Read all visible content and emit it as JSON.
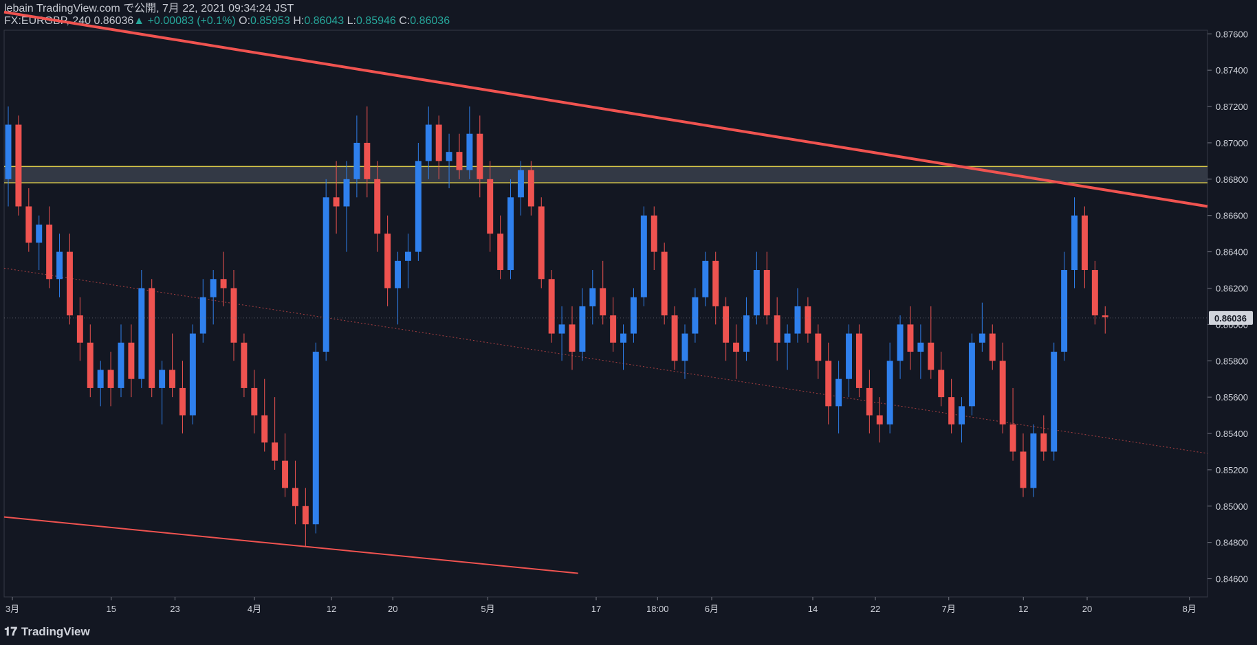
{
  "header": {
    "published": "lebain TradingView.com で公開, 7月 22, 2021 09:34:24 JST",
    "symbol": "FX:EURGBP, 240",
    "last": "0.86036",
    "change_arrow": "▲",
    "change": "+0.00083 (+0.1%)",
    "o_label": "O:",
    "o_value": "0.85953",
    "h_label": "H:",
    "h_value": "0.86043",
    "l_label": "L:",
    "l_value": "0.85946",
    "c_label": "C:",
    "c_value": "0.86036"
  },
  "footer": {
    "brand": "TradingView",
    "brand_icon": "tradingview-logo-icon"
  },
  "colors": {
    "background": "#131722",
    "up": "#2f80ed",
    "down": "#ef5350",
    "trendline": "#f05350",
    "zone_border": "#d8c84a",
    "zone_fill": "#3a3f4b",
    "grid": "#2a2e39",
    "text": "#d1d4dc",
    "last_price_badge": "#d1d4dc"
  },
  "chart_data": {
    "type": "candlestick",
    "ylim": [
      0.845,
      0.8762
    ],
    "yticks": [
      "0.87600",
      "0.87400",
      "0.87200",
      "0.87000",
      "0.86800",
      "0.86600",
      "0.86400",
      "0.86200",
      "0.86000",
      "0.85800",
      "0.85600",
      "0.85400",
      "0.85200",
      "0.85000",
      "0.84800",
      "0.84600"
    ],
    "xticks": [
      "3月",
      "15",
      "23",
      "4月",
      "12",
      "20",
      "5月",
      "17",
      "18:00",
      "6月",
      "14",
      "22",
      "7月",
      "12",
      "20",
      "8月"
    ],
    "xtick_positions": [
      0.0,
      0.089,
      0.142,
      0.208,
      0.272,
      0.323,
      0.402,
      0.492,
      0.543,
      0.588,
      0.672,
      0.724,
      0.785,
      0.847,
      0.9,
      0.985
    ],
    "last_price": "0.86036",
    "series": [
      {
        "name": "",
        "values": [
          [
            0.868,
            0.872,
            0.8665,
            0.871
          ],
          [
            0.871,
            0.8715,
            0.866,
            0.8665
          ],
          [
            0.8665,
            0.8675,
            0.864,
            0.8645
          ],
          [
            0.8645,
            0.866,
            0.863,
            0.8655
          ],
          [
            0.8655,
            0.8665,
            0.862,
            0.8625
          ],
          [
            0.8625,
            0.865,
            0.8615,
            0.864
          ],
          [
            0.864,
            0.865,
            0.86,
            0.8605
          ],
          [
            0.8605,
            0.8615,
            0.858,
            0.859
          ],
          [
            0.859,
            0.86,
            0.856,
            0.8565
          ],
          [
            0.8565,
            0.858,
            0.8555,
            0.8575
          ],
          [
            0.8575,
            0.8585,
            0.8555,
            0.8565
          ],
          [
            0.8565,
            0.86,
            0.856,
            0.859
          ],
          [
            0.859,
            0.86,
            0.856,
            0.857
          ],
          [
            0.857,
            0.863,
            0.8565,
            0.862
          ],
          [
            0.862,
            0.8625,
            0.856,
            0.8565
          ],
          [
            0.8565,
            0.858,
            0.8545,
            0.8575
          ],
          [
            0.8575,
            0.8595,
            0.856,
            0.8565
          ],
          [
            0.8565,
            0.858,
            0.854,
            0.855
          ],
          [
            0.855,
            0.86,
            0.8545,
            0.8595
          ],
          [
            0.8595,
            0.8625,
            0.859,
            0.8615
          ],
          [
            0.8615,
            0.863,
            0.86,
            0.8625
          ],
          [
            0.8625,
            0.864,
            0.861,
            0.862
          ],
          [
            0.862,
            0.863,
            0.858,
            0.859
          ],
          [
            0.859,
            0.8595,
            0.856,
            0.8565
          ],
          [
            0.8565,
            0.8575,
            0.854,
            0.855
          ],
          [
            0.855,
            0.857,
            0.853,
            0.8535
          ],
          [
            0.8535,
            0.856,
            0.852,
            0.8525
          ],
          [
            0.8525,
            0.854,
            0.8505,
            0.851
          ],
          [
            0.851,
            0.8525,
            0.849,
            0.85
          ],
          [
            0.85,
            0.851,
            0.8478,
            0.849
          ],
          [
            0.849,
            0.859,
            0.8485,
            0.8585
          ],
          [
            0.8585,
            0.868,
            0.858,
            0.867
          ],
          [
            0.867,
            0.869,
            0.865,
            0.8665
          ],
          [
            0.8665,
            0.869,
            0.864,
            0.868
          ],
          [
            0.868,
            0.8715,
            0.867,
            0.87
          ],
          [
            0.87,
            0.872,
            0.867,
            0.868
          ],
          [
            0.868,
            0.869,
            0.864,
            0.865
          ],
          [
            0.865,
            0.866,
            0.861,
            0.862
          ],
          [
            0.862,
            0.864,
            0.86,
            0.8635
          ],
          [
            0.8635,
            0.865,
            0.862,
            0.864
          ],
          [
            0.864,
            0.87,
            0.8635,
            0.869
          ],
          [
            0.869,
            0.872,
            0.868,
            0.871
          ],
          [
            0.871,
            0.8715,
            0.868,
            0.869
          ],
          [
            0.869,
            0.8705,
            0.8675,
            0.8695
          ],
          [
            0.8695,
            0.8705,
            0.868,
            0.8685
          ],
          [
            0.8685,
            0.872,
            0.868,
            0.8705
          ],
          [
            0.8705,
            0.8715,
            0.867,
            0.868
          ],
          [
            0.868,
            0.869,
            0.864,
            0.865
          ],
          [
            0.865,
            0.866,
            0.8625,
            0.863
          ],
          [
            0.863,
            0.868,
            0.8625,
            0.867
          ],
          [
            0.867,
            0.869,
            0.866,
            0.8685
          ],
          [
            0.8685,
            0.869,
            0.866,
            0.8665
          ],
          [
            0.8665,
            0.867,
            0.862,
            0.8625
          ],
          [
            0.8625,
            0.863,
            0.859,
            0.8595
          ],
          [
            0.8595,
            0.861,
            0.858,
            0.86
          ],
          [
            0.86,
            0.861,
            0.8575,
            0.8585
          ],
          [
            0.8585,
            0.862,
            0.858,
            0.861
          ],
          [
            0.861,
            0.863,
            0.86,
            0.862
          ],
          [
            0.862,
            0.8635,
            0.86,
            0.8605
          ],
          [
            0.8605,
            0.8615,
            0.8585,
            0.859
          ],
          [
            0.859,
            0.86,
            0.8575,
            0.8595
          ],
          [
            0.8595,
            0.862,
            0.859,
            0.8615
          ],
          [
            0.8615,
            0.8665,
            0.861,
            0.866
          ],
          [
            0.866,
            0.8665,
            0.863,
            0.864
          ],
          [
            0.864,
            0.8645,
            0.86,
            0.8605
          ],
          [
            0.8605,
            0.861,
            0.8575,
            0.858
          ],
          [
            0.858,
            0.86,
            0.857,
            0.8595
          ],
          [
            0.8595,
            0.862,
            0.859,
            0.8615
          ],
          [
            0.8615,
            0.864,
            0.861,
            0.8635
          ],
          [
            0.8635,
            0.864,
            0.86,
            0.861
          ],
          [
            0.861,
            0.8615,
            0.858,
            0.859
          ],
          [
            0.859,
            0.86,
            0.857,
            0.8585
          ],
          [
            0.8585,
            0.8615,
            0.858,
            0.8605
          ],
          [
            0.8605,
            0.864,
            0.86,
            0.863
          ],
          [
            0.863,
            0.864,
            0.86,
            0.8605
          ],
          [
            0.8605,
            0.8615,
            0.858,
            0.859
          ],
          [
            0.859,
            0.86,
            0.8575,
            0.8595
          ],
          [
            0.8595,
            0.862,
            0.859,
            0.861
          ],
          [
            0.861,
            0.8615,
            0.859,
            0.8595
          ],
          [
            0.8595,
            0.86,
            0.857,
            0.858
          ],
          [
            0.858,
            0.859,
            0.8545,
            0.8555
          ],
          [
            0.8555,
            0.858,
            0.854,
            0.857
          ],
          [
            0.857,
            0.86,
            0.856,
            0.8595
          ],
          [
            0.8595,
            0.86,
            0.856,
            0.8565
          ],
          [
            0.8565,
            0.8575,
            0.854,
            0.855
          ],
          [
            0.855,
            0.856,
            0.8535,
            0.8545
          ],
          [
            0.8545,
            0.859,
            0.854,
            0.858
          ],
          [
            0.858,
            0.8605,
            0.857,
            0.86
          ],
          [
            0.86,
            0.861,
            0.8575,
            0.8585
          ],
          [
            0.8585,
            0.86,
            0.857,
            0.859
          ],
          [
            0.859,
            0.861,
            0.857,
            0.8575
          ],
          [
            0.8575,
            0.8585,
            0.8555,
            0.856
          ],
          [
            0.856,
            0.857,
            0.854,
            0.8545
          ],
          [
            0.8545,
            0.856,
            0.8535,
            0.8555
          ],
          [
            0.8555,
            0.8595,
            0.855,
            0.859
          ],
          [
            0.859,
            0.8612,
            0.8585,
            0.8595
          ],
          [
            0.8595,
            0.86,
            0.8575,
            0.858
          ],
          [
            0.858,
            0.859,
            0.854,
            0.8545
          ],
          [
            0.8545,
            0.8565,
            0.8525,
            0.853
          ],
          [
            0.853,
            0.854,
            0.8505,
            0.851
          ],
          [
            0.851,
            0.8545,
            0.8505,
            0.854
          ],
          [
            0.854,
            0.855,
            0.8525,
            0.853
          ],
          [
            0.853,
            0.859,
            0.8525,
            0.8585
          ],
          [
            0.8585,
            0.864,
            0.858,
            0.863
          ],
          [
            0.863,
            0.867,
            0.862,
            0.866
          ],
          [
            0.866,
            0.8665,
            0.862,
            0.863
          ],
          [
            0.863,
            0.8635,
            0.86,
            0.8605
          ],
          [
            0.8605,
            0.861,
            0.8595,
            0.8604
          ]
        ]
      }
    ],
    "trendlines": [
      {
        "from": [
          0.0,
          0.8772
        ],
        "to": [
          1.0,
          0.8665
        ]
      },
      {
        "from": [
          0.0,
          0.8494
        ],
        "to": [
          0.477,
          0.8463
        ]
      },
      {
        "from": [
          0.0,
          0.8631
        ],
        "to": [
          1.0,
          0.8529
        ],
        "style": "dotted"
      }
    ],
    "zones": [
      {
        "from": 0.8678,
        "to": 0.8687
      }
    ]
  }
}
